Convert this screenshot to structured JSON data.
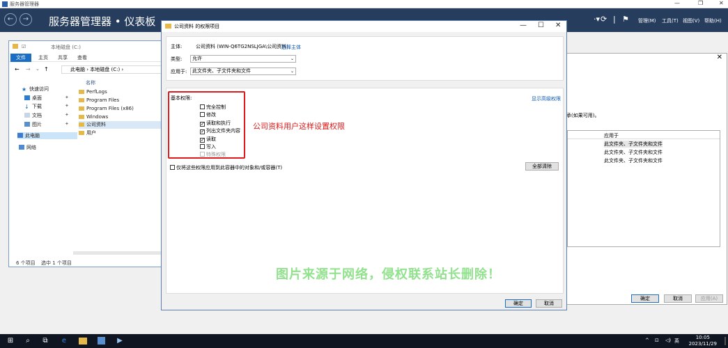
{
  "server_manager": {
    "window_title": "服务器管理器",
    "header_title": "服务器管理器 • 仪表板",
    "menu": [
      "管理(M)",
      "工具(T)",
      "视图(V)",
      "帮助(H)"
    ]
  },
  "explorer": {
    "quick_toolbar_title": "本地磁盘 (C:)",
    "ribbon_tabs": [
      "文件",
      "主页",
      "共享",
      "查看"
    ],
    "address": "此电脑 › 本地磁盘 (C:) ›",
    "column_name": "名称",
    "nav": [
      "快速访问",
      "桌面",
      "下载",
      "文档",
      "图片",
      "此电脑",
      "网络"
    ],
    "files": [
      "PerfLogs",
      "Program Files",
      "Program Files (x86)",
      "Windows",
      "公司资料",
      "用户"
    ],
    "status_count": "6 个项目",
    "status_selected": "选中 1 个项目"
  },
  "bg_dialog": {
    "text": "继承(如果可用)。",
    "column_apply": "应用于",
    "rows": [
      "此文件夹、子文件夹和文件",
      "此文件夹、子文件夹和文件",
      "此文件夹、子文件夹和文件"
    ],
    "ok": "确定",
    "cancel": "取消",
    "apply": "应用(A)"
  },
  "dialog": {
    "title": "公司资料 的权限项目",
    "principal_label": "主体:",
    "principal_value": "公司资料 (WIN-Q6TG2NSLJGA\\公司资料)",
    "select_principal": "选择主体",
    "type_label": "类型:",
    "type_value": "允许",
    "applies_label": "应用于:",
    "applies_value": "此文件夹、子文件夹和文件",
    "basic_perms_label": "基本权限:",
    "show_advanced": "显示高级权限",
    "permissions": [
      {
        "label": "完全控制",
        "checked": false
      },
      {
        "label": "修改",
        "checked": false
      },
      {
        "label": "读取和执行",
        "checked": true
      },
      {
        "label": "列出文件夹内容",
        "checked": true
      },
      {
        "label": "读取",
        "checked": true
      },
      {
        "label": "写入",
        "checked": false
      },
      {
        "label": "特殊权限",
        "checked": false
      }
    ],
    "apply_only_label": "仅将这些权限应用到此容器中的对象和/或容器(T)",
    "clear_all": "全部清除",
    "ok": "确定",
    "cancel": "取消"
  },
  "annotation": "公司资料用户这样设置权限",
  "watermark": "图片来源于网络，侵权联系站长删除！",
  "taskbar": {
    "lang": "英",
    "time": "10:05",
    "date": "2023/11/29"
  }
}
